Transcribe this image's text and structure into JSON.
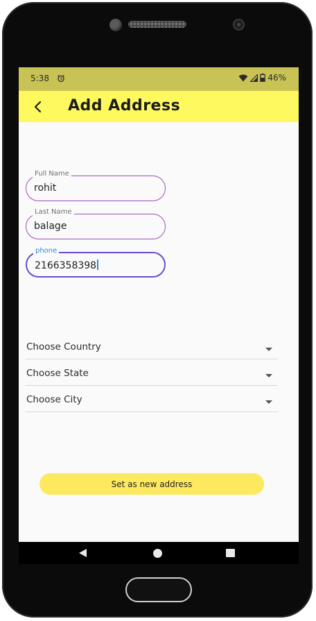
{
  "status_bar": {
    "time": "5:38",
    "battery": "46%"
  },
  "app_bar": {
    "title": "Add Address"
  },
  "form": {
    "full_name": {
      "label": "Full Name",
      "value": "rohit"
    },
    "last_name": {
      "label": "Last Name",
      "value": "balage"
    },
    "phone": {
      "label": "phone",
      "value": "2166358398"
    }
  },
  "dropdowns": {
    "country": "Choose Country",
    "state": "Choose State",
    "city": "Choose City"
  },
  "submit": {
    "label": "Set as new address"
  },
  "colors": {
    "status_bar": "#c8c354",
    "app_bar": "#fef95e",
    "button": "#fde95f",
    "field_border": "#9c4fb5",
    "focused_border": "#6a4bd1",
    "focused_label": "#2f86d8"
  }
}
